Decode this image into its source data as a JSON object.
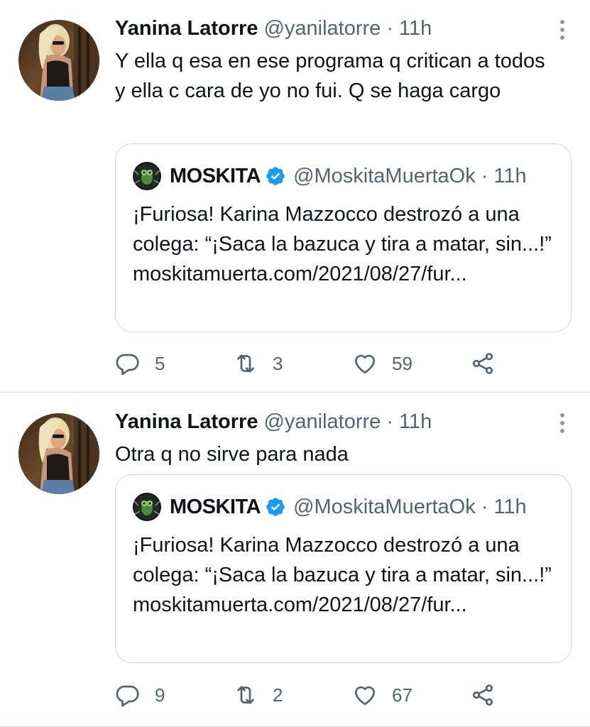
{
  "tweets": [
    {
      "author_name": "Yanina Latorre",
      "author_handle": "@yanilatorre",
      "separator": "·",
      "time": "11h",
      "text": "Y ella q esa en ese programa q critican a todos y ella c cara de yo no fui. Q se haga cargo",
      "quote": {
        "author_name": "MOSKITA",
        "author_handle": "@MoskitaMuertaOk",
        "separator": "·",
        "time": "11h",
        "text": "¡Furiosa! Karina Mazzocco destrozó a una colega: “¡Saca la bazuca y tira a matar, sin...!” moskitamuerta.com/2021/08/27/fur..."
      },
      "stats": {
        "replies": "5",
        "retweets": "3",
        "likes": "59"
      }
    },
    {
      "author_name": "Yanina Latorre",
      "author_handle": "@yanilatorre",
      "separator": "·",
      "time": "11h",
      "text": "Otra q no sirve para nada",
      "quote": {
        "author_name": "MOSKITA",
        "author_handle": "@MoskitaMuertaOk",
        "separator": "·",
        "time": "11h",
        "text": "¡Furiosa! Karina Mazzocco destrozó a una colega: “¡Saca la bazuca y tira a matar, sin...!” moskitamuerta.com/2021/08/27/fur..."
      },
      "stats": {
        "replies": "9",
        "retweets": "2",
        "likes": "67"
      }
    }
  ],
  "icons": {
    "reply": "reply-icon",
    "retweet": "retweet-icon",
    "like": "heart-icon",
    "share": "share-icon",
    "more": "more-options-icon",
    "verified": "verified-badge-icon"
  },
  "colors": {
    "text": "#0f1419",
    "secondary": "#536471",
    "border": "#cfd9de",
    "verified": "#1d9bf0"
  }
}
